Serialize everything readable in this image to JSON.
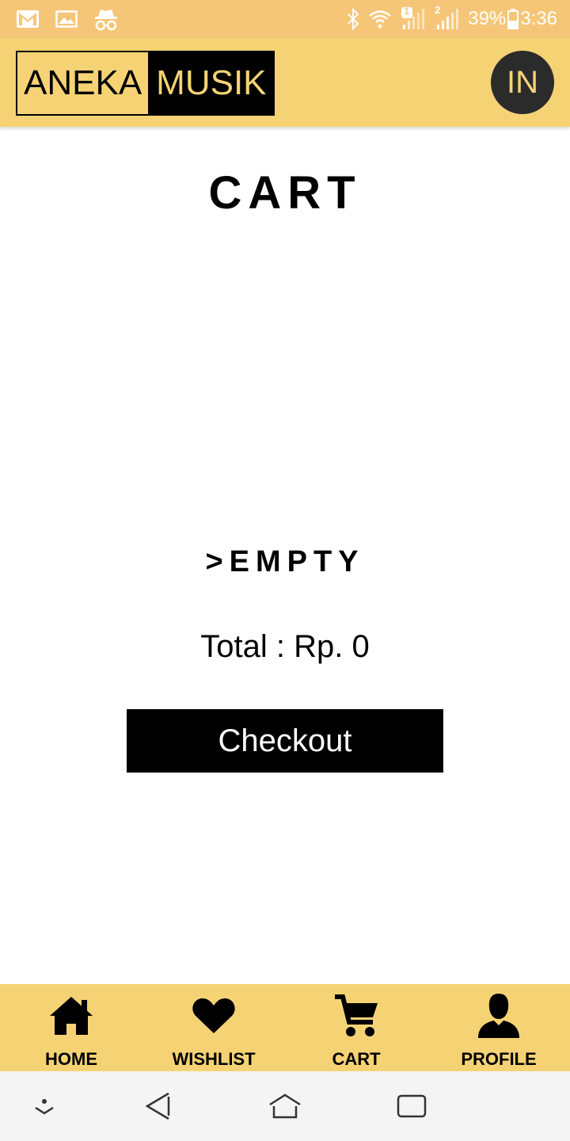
{
  "status_bar": {
    "icons_left": [
      "gmail-icon",
      "gallery-icon",
      "incognito-icon"
    ],
    "icons_right": [
      "bluetooth-icon",
      "wifi-icon",
      "signal-1-icon",
      "signal-2-icon"
    ],
    "sim1_badge": "1",
    "sim2_badge": "2",
    "battery": "39%",
    "time": "3:36"
  },
  "header": {
    "logo_left": "ANEKA",
    "logo_right": "MUSIK",
    "avatar_initials": "IN"
  },
  "main": {
    "title": "CART",
    "empty_text": ">EMPTY",
    "total_text": "Total : Rp. 0",
    "checkout_label": "Checkout"
  },
  "bottom_nav": {
    "items": [
      {
        "label": "HOME",
        "icon": "home-icon"
      },
      {
        "label": "WISHLIST",
        "icon": "heart-icon"
      },
      {
        "label": "CART",
        "icon": "cart-icon"
      },
      {
        "label": "PROFILE",
        "icon": "person-icon"
      }
    ]
  },
  "system_nav": [
    "collapse-icon",
    "back-icon",
    "home-outline-icon",
    "recents-icon"
  ],
  "colors": {
    "status_bar": "#f6c678",
    "accent": "#f5d375",
    "dark": "#000000",
    "avatar_bg": "#2b2b2b",
    "system_nav_bg": "#f4f4f4"
  }
}
